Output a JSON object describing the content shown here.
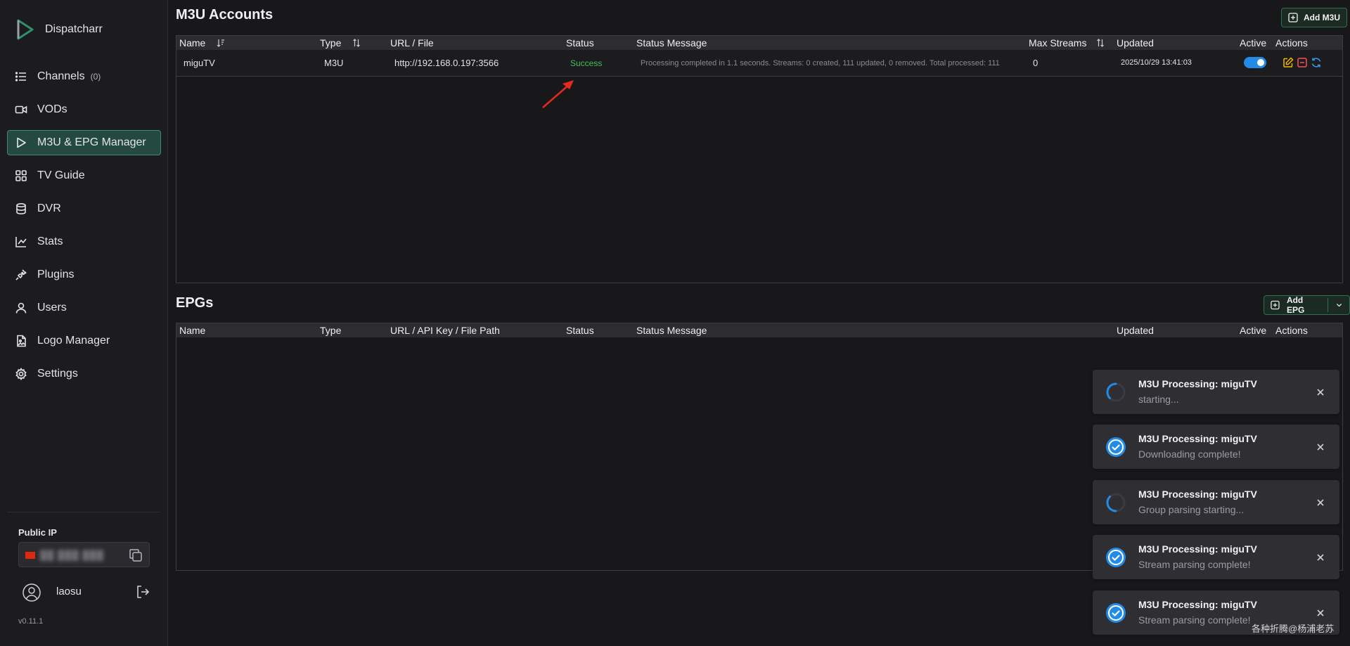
{
  "app": {
    "name": "Dispatcharr",
    "version": "v0.11.1",
    "accent_color": "#3f8a73",
    "success_color": "#40c057",
    "toggle_color": "#228be6"
  },
  "sidebar": {
    "items": [
      {
        "label": "Channels",
        "count": "(0)",
        "icon": "list-icon"
      },
      {
        "label": "VODs",
        "icon": "video-icon"
      },
      {
        "label": "M3U & EPG Manager",
        "icon": "play-icon"
      },
      {
        "label": "TV Guide",
        "icon": "grid-icon"
      },
      {
        "label": "DVR",
        "icon": "database-icon"
      },
      {
        "label": "Stats",
        "icon": "chart-line-icon"
      },
      {
        "label": "Plugins",
        "icon": "plug-icon"
      },
      {
        "label": "Users",
        "icon": "user-icon"
      },
      {
        "label": "Logo Manager",
        "icon": "file-image-icon"
      },
      {
        "label": "Settings",
        "icon": "gear-icon"
      }
    ],
    "public_ip_label": "Public IP",
    "public_ip_value": "██ ███ ███",
    "username": "laosu"
  },
  "m3u": {
    "title": "M3U Accounts",
    "add_label": "Add M3U",
    "columns": {
      "name": "Name",
      "type": "Type",
      "url": "URL / File",
      "status": "Status",
      "status_message": "Status Message",
      "max_streams": "Max Streams",
      "updated": "Updated",
      "active": "Active",
      "actions": "Actions"
    },
    "rows": [
      {
        "name": "miguTV",
        "type": "M3U",
        "url": "http://192.168.0.197:3566",
        "status": "Success",
        "status_message": "Processing completed in 1.1 seconds. Streams: 0 created, 111 updated, 0 removed. Total processed: 111",
        "max_streams": "0",
        "updated": "2025/10/29 13:41:03",
        "active": true
      }
    ]
  },
  "epg": {
    "title": "EPGs",
    "add_label": "Add EPG",
    "columns": {
      "name": "Name",
      "type": "Type",
      "url": "URL / API Key / File Path",
      "status": "Status",
      "status_message": "Status Message",
      "updated": "Updated",
      "active": "Active",
      "actions": "Actions"
    }
  },
  "notifications": [
    {
      "title": "M3U Processing: miguTV",
      "message": "starting...",
      "icon": "spinner-icon"
    },
    {
      "title": "M3U Processing: miguTV",
      "message": "Downloading complete!",
      "icon": "check-circle-icon"
    },
    {
      "title": "M3U Processing: miguTV",
      "message": "Group parsing starting...",
      "icon": "spinner-icon"
    },
    {
      "title": "M3U Processing: miguTV",
      "message": "Stream parsing complete!",
      "icon": "check-circle-icon"
    },
    {
      "title": "M3U Processing: miguTV",
      "message": "Stream parsing complete!",
      "icon": "check-circle-icon"
    }
  ],
  "watermark": "各种折腾@杨浦老苏"
}
